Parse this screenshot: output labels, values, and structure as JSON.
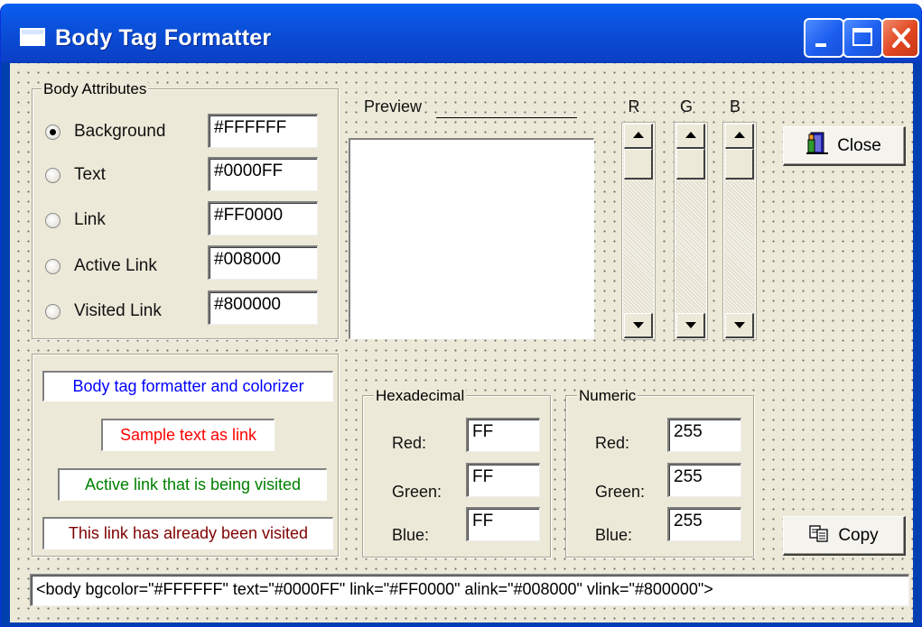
{
  "window": {
    "title": "Body Tag Formatter"
  },
  "body_attributes": {
    "group_title": "Body Attributes",
    "rows": [
      {
        "label": "Background",
        "value": "#FFFFFF",
        "checked": true
      },
      {
        "label": "Text",
        "value": "#0000FF",
        "checked": false
      },
      {
        "label": "Link",
        "value": "#FF0000",
        "checked": false
      },
      {
        "label": "Active Link",
        "value": "#008000",
        "checked": false
      },
      {
        "label": "Visited Link",
        "value": "#800000",
        "checked": false
      }
    ]
  },
  "preview": {
    "label": "Preview",
    "color": "#FFFFFF"
  },
  "sliders": [
    {
      "label": "R",
      "value": 255
    },
    {
      "label": "G",
      "value": 255
    },
    {
      "label": "B",
      "value": 255
    }
  ],
  "buttons": {
    "close": "Close",
    "copy": "Copy"
  },
  "samples": [
    {
      "text": "Body tag formatter and colorizer",
      "color": "#0000FF"
    },
    {
      "text": "Sample text as link",
      "color": "#FF0000"
    },
    {
      "text": "Active link that is being visited",
      "color": "#008000"
    },
    {
      "text": "This link has already been visited",
      "color": "#800000"
    }
  ],
  "hexadecimal": {
    "group_title": "Hexadecimal",
    "red_label": "Red:",
    "red": "FF",
    "green_label": "Green:",
    "green": "FF",
    "blue_label": "Blue:",
    "blue": "FF"
  },
  "numeric": {
    "group_title": "Numeric",
    "red_label": "Red:",
    "red": "255",
    "green_label": "Green:",
    "green": "255",
    "blue_label": "Blue:",
    "blue": "255"
  },
  "output": "<body bgcolor=\"#FFFFFF\" text=\"#0000FF\" link=\"#FF0000\" alink=\"#008000\" vlink=\"#800000\">"
}
